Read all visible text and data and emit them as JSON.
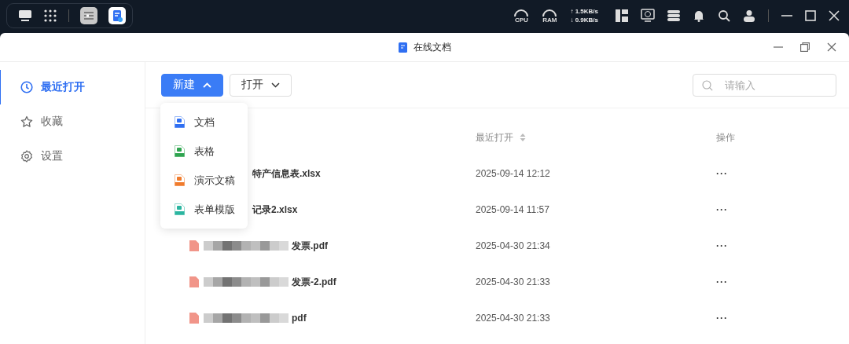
{
  "taskbar": {
    "cpu_label": "CPU",
    "ram_label": "RAM",
    "upload": "↑ 1.5KB/s",
    "download": "↓ 0.9KB/s"
  },
  "window": {
    "title": "在线文档"
  },
  "sidebar": {
    "items": [
      {
        "label": "最近打开",
        "kind": "clock",
        "selected": true
      },
      {
        "label": "收藏",
        "kind": "star",
        "selected": false
      },
      {
        "label": "设置",
        "kind": "gear",
        "selected": false
      }
    ]
  },
  "toolbar": {
    "new_button": "新建",
    "open_button": "打开",
    "search": {
      "placeholder": "请输入"
    }
  },
  "new_menu": {
    "expanded": true,
    "items": [
      {
        "label": "文档",
        "kind": "doc"
      },
      {
        "label": "表格",
        "kind": "sheet"
      },
      {
        "label": "演示文稿",
        "kind": "slides"
      },
      {
        "label": "表单模版",
        "kind": "form"
      }
    ]
  },
  "table": {
    "columns": [
      {
        "label": "最近打开",
        "sortable": true
      },
      {
        "label": "操作",
        "sortable": false
      }
    ],
    "rows": [
      {
        "name": "特产信息表.xlsx",
        "redacted": false,
        "opened": "2025-09-14 12:12",
        "action": "···"
      },
      {
        "name": "记录2.xlsx",
        "redacted": false,
        "opened": "2025-09-14 11:57",
        "action": "···"
      },
      {
        "name": "发票.pdf",
        "kind": "pdf",
        "redacted": true,
        "opened": "2025-04-30 21:34",
        "action": "···"
      },
      {
        "name": "发票-2.pdf",
        "kind": "pdf",
        "redacted": true,
        "opened": "2025-04-30 21:33",
        "action": "···"
      },
      {
        "name": "pdf",
        "kind": "pdf",
        "redacted": true,
        "opened": "2025-04-30 21:33",
        "action": "···"
      }
    ]
  }
}
